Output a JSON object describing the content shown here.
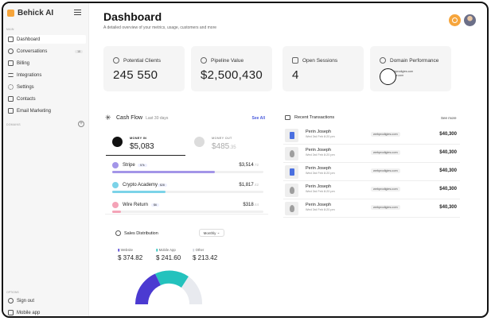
{
  "app": {
    "name": "Behick AI"
  },
  "sidebar": {
    "section_main": "MAIN",
    "items": [
      {
        "label": "Dashboard",
        "icon": "grid-icon",
        "active": true
      },
      {
        "label": "Conversations",
        "icon": "chat-icon",
        "badge": "18"
      },
      {
        "label": "Billing",
        "icon": "card-icon"
      },
      {
        "label": "Integrations",
        "icon": "sliders-icon"
      },
      {
        "label": "Settings",
        "icon": "gear-icon"
      },
      {
        "label": "Contacts",
        "icon": "contact-icon"
      },
      {
        "label": "Email Marketing",
        "icon": "mail-icon"
      }
    ],
    "section_domains": "DOMAINS",
    "section_options": "OPTIONS",
    "bottom_items": [
      {
        "label": "Sign out",
        "icon": "signout-icon"
      },
      {
        "label": "Mobile app",
        "icon": "mobile-icon"
      }
    ]
  },
  "header": {
    "title": "Dashboard",
    "subtitle": "A detailed overview of your metrics, usage, customers and more"
  },
  "stats": [
    {
      "label": "Potential Clients",
      "value": "245 550",
      "icon": "user-icon"
    },
    {
      "label": "Pipeline Value",
      "value": "$2,500,430",
      "icon": "dollar-icon"
    },
    {
      "label": "Open Sessions",
      "value": "4",
      "icon": "chat-icon"
    },
    {
      "label": "Domain Performance",
      "icon": "user-icon",
      "domains": [
        "webprodigies.com",
        "apple.com"
      ]
    }
  ],
  "cash_flow": {
    "title": "Cash Flow",
    "period": "Last 30 days",
    "see_all": "See All",
    "money_in": {
      "label": "MONEY IN",
      "value": "$5,083"
    },
    "money_out": {
      "label": "MONEY OUT",
      "value": "$485",
      "cents": ".35"
    },
    "rows": [
      {
        "name": "Stripe",
        "tag": "57k",
        "amount": "$3,514",
        "cents": ".72",
        "color": "#a395e8",
        "fill": 0.68
      },
      {
        "name": "Crypto Academy",
        "tag": "$28",
        "amount": "$1,817",
        "cents": ".42",
        "color": "#7cd3e8",
        "fill": 0.35
      },
      {
        "name": "Wire Return",
        "tag": "$6",
        "amount": "$318",
        "cents": ".44",
        "color": "#f4a3b7",
        "fill": 0.06
      }
    ]
  },
  "sales": {
    "title": "Sales Distribution",
    "filter": "Monthly",
    "items": [
      {
        "label": "Website",
        "value": "$ 374.82",
        "color": "#4b3ad1"
      },
      {
        "label": "Mobile App",
        "value": "$ 241.60",
        "color": "#24c2bd"
      },
      {
        "label": "Other",
        "value": "$ 213.42",
        "color": "#e8eaef"
      }
    ]
  },
  "transactions": {
    "title": "Recent Transactions",
    "see_more": "See more",
    "rows": [
      {
        "name": "Perin Joseph",
        "date": "Wed 3rd Feb 8:20 pm",
        "tag": "webprodigies.com",
        "amount": "$40,300",
        "icon_color": "#4a6fe0"
      },
      {
        "name": "Perin Joseph",
        "date": "Wed 3rd Feb 8:20 pm",
        "tag": "webprodigies.com",
        "amount": "$40,300",
        "icon_color": "#9e9e9e"
      },
      {
        "name": "Perin Joseph",
        "date": "Wed 3rd Feb 8:20 pm",
        "tag": "webprodigies.com",
        "amount": "$40,300",
        "icon_color": "#4a6fe0"
      },
      {
        "name": "Perin Joseph",
        "date": "Wed 3rd Feb 8:20 pm",
        "tag": "webprodigies.com",
        "amount": "$40,300",
        "icon_color": "#9e9e9e"
      },
      {
        "name": "Perin Joseph",
        "date": "Wed 3rd Feb 8:20 pm",
        "tag": "webprodigies.com",
        "amount": "$40,300",
        "icon_color": "#9e9e9e"
      }
    ]
  }
}
